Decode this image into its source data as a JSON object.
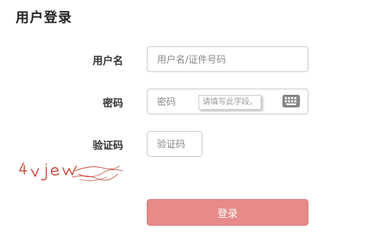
{
  "page": {
    "title": "用户登录"
  },
  "form": {
    "username": {
      "label": "用户名",
      "placeholder": "用户名/证件号码",
      "value": ""
    },
    "password": {
      "label": "密码",
      "placeholder": "密码",
      "value": "",
      "tooltip": "请填写此字段。"
    },
    "captcha": {
      "label": "验证码",
      "placeholder": "验证码",
      "value": "",
      "image_text": "4vjew"
    },
    "submit_label": "登录"
  },
  "colors": {
    "button_bg": "#e88a88",
    "captcha_ink": "#c0392b",
    "input_border": "#cccccc"
  },
  "icons": {
    "keyboard": "keyboard-icon"
  }
}
